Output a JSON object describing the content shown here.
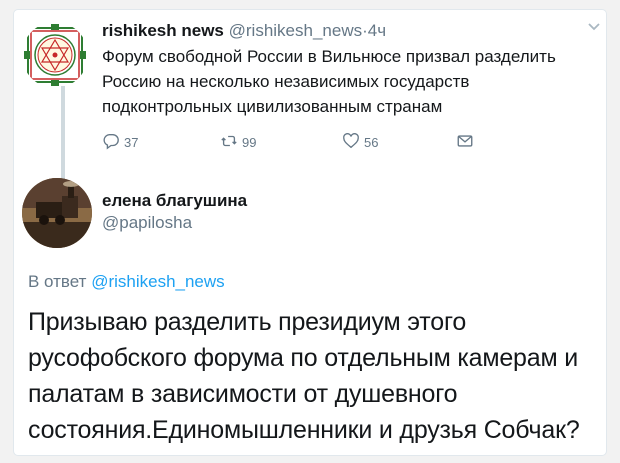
{
  "tweet": {
    "author_name": "rishikesh news",
    "author_handle": "@rishikesh_news",
    "separator": "·",
    "time": "4ч",
    "text": "Форум свободной России в Вильнюсе призвал разделить Россию на несколько независимых государств подконтрольных цивилизованным странам",
    "reply_count": "37",
    "retweet_count": "99",
    "like_count": "56"
  },
  "reply": {
    "author_name": "елена благушина",
    "author_handle": "@papilosha",
    "reply_prefix": "В ответ",
    "reply_to_handle": "@rishikesh_news",
    "text": "Призываю разделить президиум этого русофобского форума по отдельным камерам и палатам в зависимости от душевного состояния.Единомышленники и друзья Собчак?"
  },
  "colors": {
    "link": "#1da1f2",
    "muted": "#657786",
    "text": "#14171a"
  },
  "icons": [
    "reply-icon",
    "retweet-icon",
    "like-icon",
    "direct-message-icon",
    "chevron-down-icon"
  ]
}
